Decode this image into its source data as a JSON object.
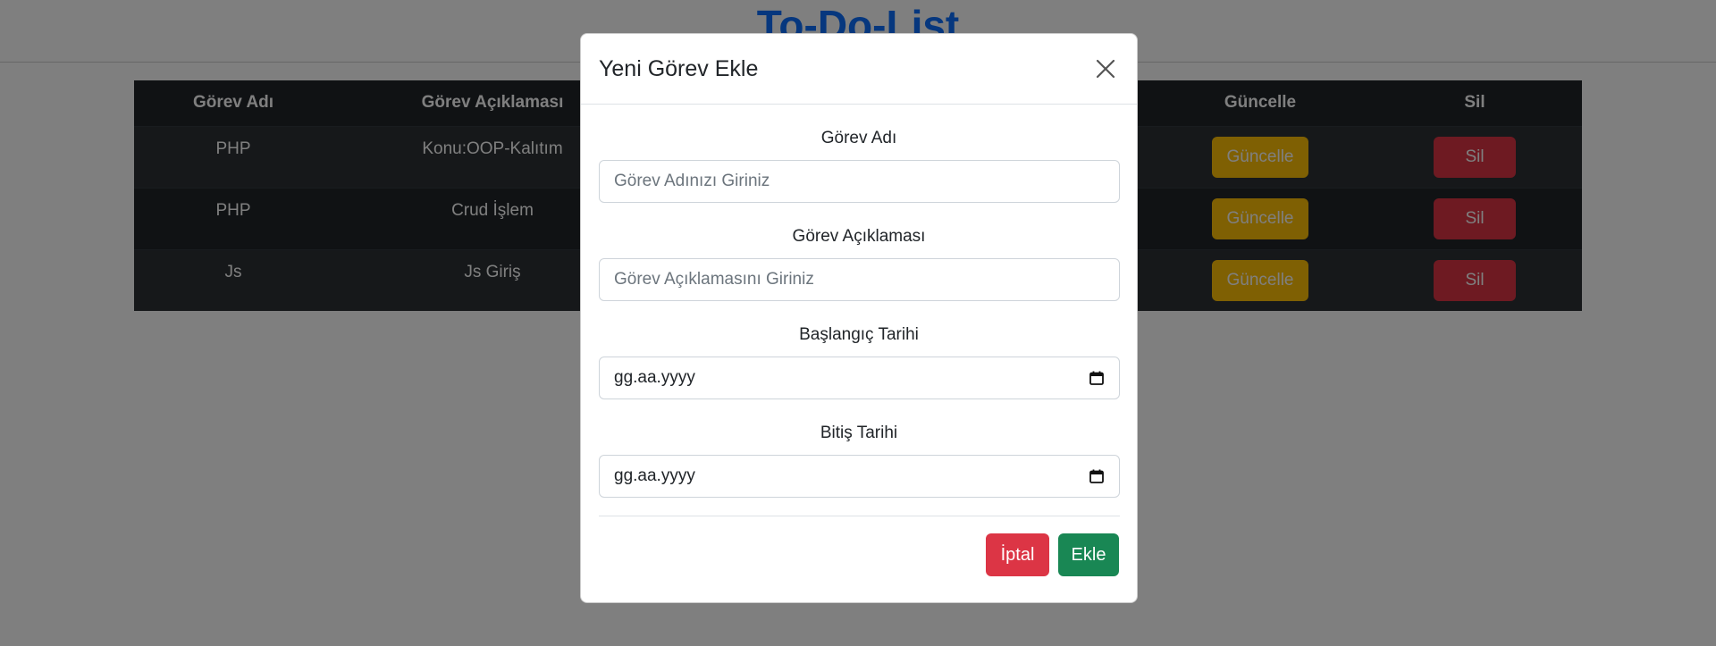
{
  "page": {
    "title": "To-Do-List"
  },
  "table": {
    "headers": [
      "Görev Adı",
      "Görev Açıklaması",
      "",
      "",
      "Güncelle",
      "Sil"
    ],
    "rows": [
      {
        "name": "PHP",
        "description": "Konu:OOP-Kalıtım",
        "update_label": "Güncelle",
        "delete_label": "Sil"
      },
      {
        "name": "PHP",
        "description": "Crud İşlem",
        "update_label": "Güncelle",
        "delete_label": "Sil"
      },
      {
        "name": "Js",
        "description": "Js Giriş",
        "update_label": "Güncelle",
        "delete_label": "Sil"
      }
    ]
  },
  "modal": {
    "title": "Yeni Görev Ekle",
    "fields": {
      "task_name": {
        "label": "Görev Adı",
        "placeholder": "Görev Adınızı Giriniz"
      },
      "task_description": {
        "label": "Görev Açıklaması",
        "placeholder": "Görev Açıklamasını Giriniz"
      },
      "start_date": {
        "label": "Başlangıç Tarihi",
        "value": "gg.aa.yyyy"
      },
      "end_date": {
        "label": "Bitiş Tarihi",
        "value": "gg.aa.yyyy"
      }
    },
    "cancel_label": "İptal",
    "add_label": "Ekle",
    "close_icon": "close-icon"
  },
  "colors": {
    "primary": "#0d6efd",
    "warning": "#ffc107",
    "danger": "#dc3545",
    "success": "#198754",
    "table_dark": "#212529"
  }
}
